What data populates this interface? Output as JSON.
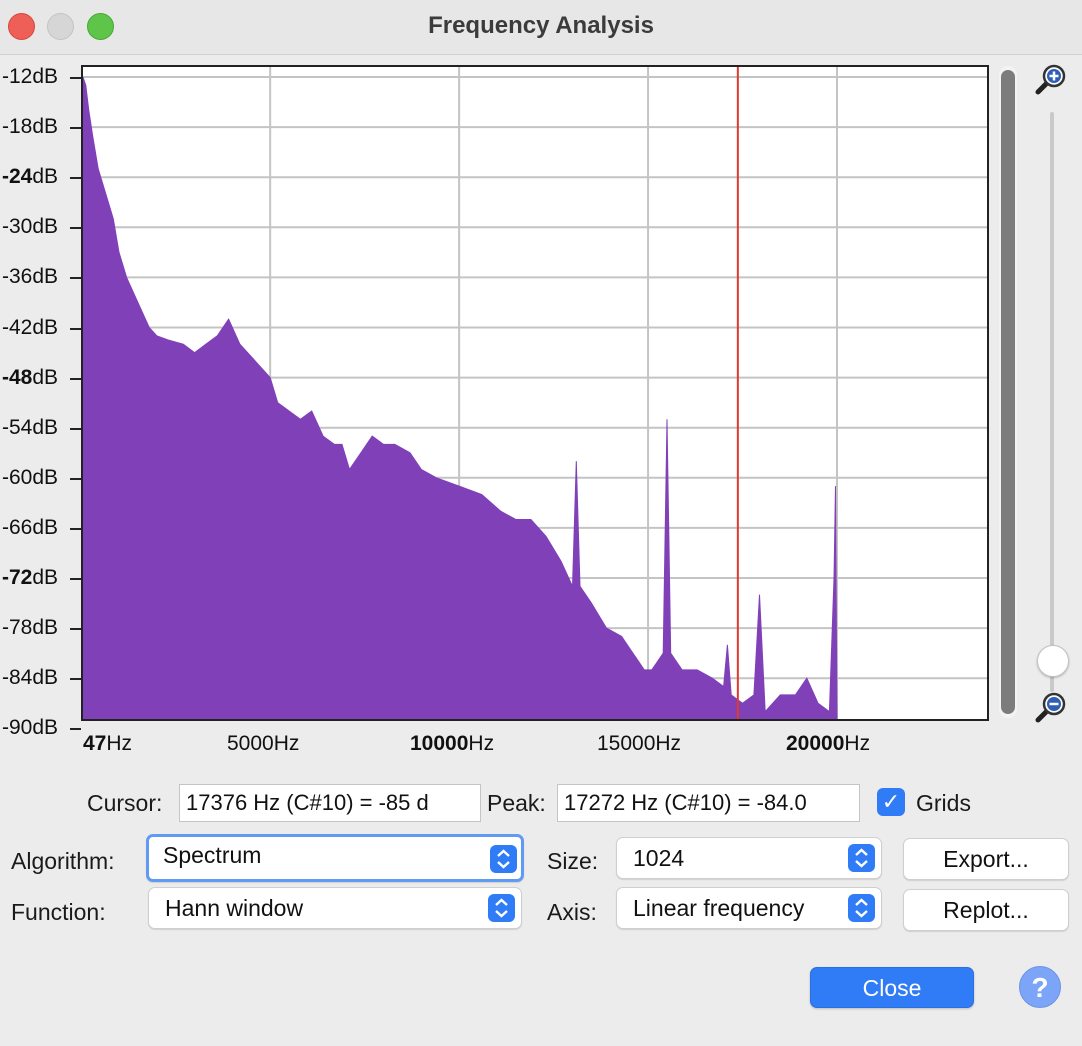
{
  "window": {
    "title": "Frequency Analysis"
  },
  "chart_data": {
    "type": "area",
    "title": "",
    "xlabel": "",
    "ylabel": "",
    "xlim": [
      47,
      24000
    ],
    "ylim": [
      -91,
      -12
    ],
    "grid": true,
    "y_ticks": [
      {
        "pre": "",
        "bold": "",
        "post": "-12dB",
        "v": -12
      },
      {
        "pre": "",
        "bold": "",
        "post": "-18dB",
        "v": -18
      },
      {
        "pre": "",
        "bold": "-24",
        "post": "dB",
        "v": -24
      },
      {
        "pre": "",
        "bold": "",
        "post": "-30dB",
        "v": -30
      },
      {
        "pre": "",
        "bold": "",
        "post": "-36dB",
        "v": -36
      },
      {
        "pre": "",
        "bold": "",
        "post": "-42dB",
        "v": -42
      },
      {
        "pre": "",
        "bold": "-48",
        "post": "dB",
        "v": -48
      },
      {
        "pre": "",
        "bold": "",
        "post": "-54dB",
        "v": -54
      },
      {
        "pre": "",
        "bold": "",
        "post": "-60dB",
        "v": -60
      },
      {
        "pre": "",
        "bold": "",
        "post": "-66dB",
        "v": -66
      },
      {
        "pre": "",
        "bold": "-72",
        "post": "dB",
        "v": -72
      },
      {
        "pre": "",
        "bold": "",
        "post": "-78dB",
        "v": -78
      },
      {
        "pre": "",
        "bold": "",
        "post": "-84dB",
        "v": -84
      },
      {
        "pre": "",
        "bold": "",
        "post": "-90dB",
        "v": -90
      }
    ],
    "x_ticks": [
      {
        "bold": "47",
        "post": "Hz",
        "v": 47
      },
      {
        "bold": "",
        "post": "5000Hz",
        "v": 5000
      },
      {
        "bold": "10000",
        "post": "Hz",
        "v": 10000
      },
      {
        "bold": "",
        "post": "15000Hz",
        "v": 15000
      },
      {
        "bold": "20000",
        "post": "Hz",
        "v": 20000
      }
    ],
    "cursor_hz": 17376,
    "color": "#8040b8",
    "series": [
      {
        "points": [
          [
            47,
            -12
          ],
          [
            120,
            -13
          ],
          [
            200,
            -16
          ],
          [
            300,
            -19
          ],
          [
            450,
            -23
          ],
          [
            650,
            -26
          ],
          [
            850,
            -29
          ],
          [
            1000,
            -33
          ],
          [
            1200,
            -36
          ],
          [
            1400,
            -38
          ],
          [
            1600,
            -40
          ],
          [
            1800,
            -42
          ],
          [
            2000,
            -43
          ],
          [
            2300,
            -43.5
          ],
          [
            2700,
            -44
          ],
          [
            3000,
            -45
          ],
          [
            3300,
            -44
          ],
          [
            3600,
            -43
          ],
          [
            3900,
            -41
          ],
          [
            4200,
            -44
          ],
          [
            4600,
            -46
          ],
          [
            5000,
            -48
          ],
          [
            5200,
            -51
          ],
          [
            5500,
            -52
          ],
          [
            5800,
            -53
          ],
          [
            6100,
            -52
          ],
          [
            6400,
            -55
          ],
          [
            6700,
            -56
          ],
          [
            6900,
            -56
          ],
          [
            7100,
            -59
          ],
          [
            7400,
            -57
          ],
          [
            7700,
            -55
          ],
          [
            8000,
            -56
          ],
          [
            8300,
            -56
          ],
          [
            8700,
            -57
          ],
          [
            9000,
            -59
          ],
          [
            9400,
            -60
          ],
          [
            10000,
            -61
          ],
          [
            10600,
            -62
          ],
          [
            11100,
            -64
          ],
          [
            11500,
            -65
          ],
          [
            11900,
            -65
          ],
          [
            12300,
            -67
          ],
          [
            12700,
            -70
          ],
          [
            13000,
            -73
          ],
          [
            13100,
            -58
          ],
          [
            13200,
            -73
          ],
          [
            13500,
            -75
          ],
          [
            13900,
            -78
          ],
          [
            14300,
            -79
          ],
          [
            14600,
            -81
          ],
          [
            14900,
            -83
          ],
          [
            15100,
            -83
          ],
          [
            15400,
            -81
          ],
          [
            15500,
            -53
          ],
          [
            15600,
            -81
          ],
          [
            15900,
            -83
          ],
          [
            16300,
            -83
          ],
          [
            16700,
            -84
          ],
          [
            17000,
            -85
          ],
          [
            17100,
            -80
          ],
          [
            17200,
            -86
          ],
          [
            17500,
            -87
          ],
          [
            17800,
            -86
          ],
          [
            17950,
            -74
          ],
          [
            18100,
            -88
          ],
          [
            18500,
            -86
          ],
          [
            18900,
            -86
          ],
          [
            19200,
            -84
          ],
          [
            19500,
            -87
          ],
          [
            19800,
            -88
          ],
          [
            19920,
            -72
          ],
          [
            19960,
            -61
          ],
          [
            20000,
            -91
          ]
        ]
      }
    ]
  },
  "labels": {
    "cursor": "Cursor:",
    "peak": "Peak:",
    "grids": "Grids",
    "algorithm": "Algorithm:",
    "function": "Function:",
    "size": "Size:",
    "axis": "Axis:"
  },
  "fields": {
    "cursor_value": "17376 Hz (C#10) = -85 d",
    "peak_value": "17272 Hz (C#10) = -84.0"
  },
  "selects": {
    "algorithm": "Spectrum",
    "function": "Hann window",
    "size": "1024",
    "axis": "Linear frequency"
  },
  "buttons": {
    "export": "Export...",
    "replot": "Replot...",
    "close": "Close",
    "help": "?"
  },
  "icons": {
    "zoom_in": "zoom-in-icon",
    "zoom_out": "zoom-out-icon",
    "check": "checkmark-icon"
  }
}
